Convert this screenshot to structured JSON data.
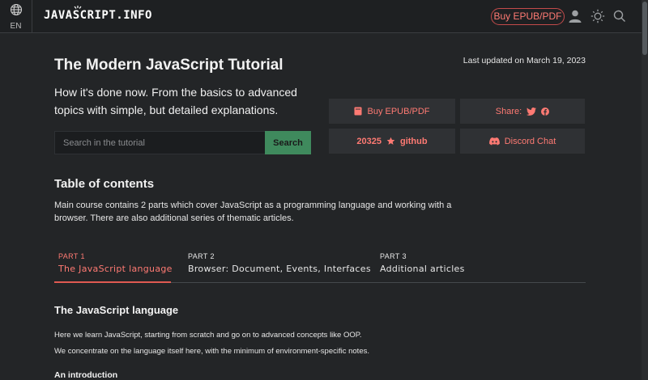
{
  "header": {
    "lang_code": "EN",
    "logo_text": "JAVASCRIPT.INFO",
    "buy_label": "Buy EPUB/PDF"
  },
  "hero": {
    "title": "The Modern JavaScript Tutorial",
    "last_updated": "Last updated on March 19, 2023",
    "subtitle": "How it's done now. From the basics to advanced topics with simple, but detailed explanations.",
    "search_placeholder": "Search in the tutorial",
    "search_button": "Search"
  },
  "cards": {
    "buy": "Buy EPUB/PDF",
    "share": "Share:",
    "github_count": "20325",
    "github_label": "github",
    "discord": "Discord Chat"
  },
  "toc": {
    "title": "Table of contents",
    "description": "Main course contains 2 parts which cover JavaScript as a programming language and working with a browser. There are also additional series of thematic articles.",
    "tabs": [
      {
        "kicker": "PART 1",
        "label": "The JavaScript language",
        "active": true
      },
      {
        "kicker": "PART 2",
        "label": "Browser: Document, Events, Interfaces",
        "active": false
      },
      {
        "kicker": "PART 3",
        "label": "Additional articles",
        "active": false
      }
    ]
  },
  "section": {
    "title": "The JavaScript language",
    "para1": "Here we learn JavaScript, starting from scratch and go on to advanced concepts like OOP.",
    "para2": "We concentrate on the language itself here, with the minimum of environment-specific notes.",
    "subheading": "An introduction"
  },
  "colors": {
    "background": "#232527",
    "accent": "#ff7a73",
    "search_button": "#3f8a5d"
  },
  "icons": [
    "globe-icon",
    "user-icon",
    "sun-icon",
    "search-icon",
    "book-icon",
    "twitter-icon",
    "facebook-icon",
    "star-icon",
    "discord-icon"
  ]
}
